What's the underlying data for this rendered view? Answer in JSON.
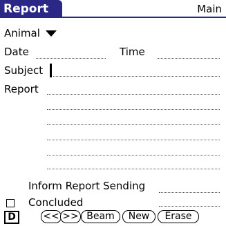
{
  "header": {
    "title": "Report",
    "category": "Main"
  },
  "animal": {
    "label": "Animal"
  },
  "date": {
    "label": "Date"
  },
  "time": {
    "label": "Time"
  },
  "subject": {
    "label": "Subject"
  },
  "report": {
    "label": "Report"
  },
  "inform": {
    "label": "Inform Report Sending"
  },
  "concluded": {
    "label": "Concluded",
    "checked": false
  },
  "toolbar": {
    "d_label": "D",
    "prev_label": "<<",
    "next_label": ">>",
    "beam_label": "Beam",
    "new_label": "New",
    "erase_label": "Erase"
  }
}
